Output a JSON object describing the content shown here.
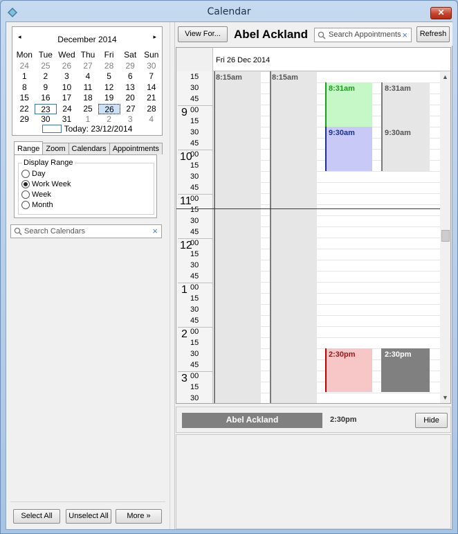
{
  "window": {
    "title": "Calendar",
    "close_label": "✕"
  },
  "mini_calendar": {
    "prev_label": "◂",
    "next_label": "▸",
    "month_title": "December 2014",
    "day_headers": [
      "Mon",
      "Tue",
      "Wed",
      "Thu",
      "Fri",
      "Sat",
      "Sun"
    ],
    "weeks": [
      [
        "24",
        "25",
        "26",
        "27",
        "28",
        "29",
        "30"
      ],
      [
        "1",
        "2",
        "3",
        "4",
        "5",
        "6",
        "7"
      ],
      [
        "8",
        "9",
        "10",
        "11",
        "12",
        "13",
        "14"
      ],
      [
        "15",
        "16",
        "17",
        "18",
        "19",
        "20",
        "21"
      ],
      [
        "22",
        "23",
        "24",
        "25",
        "26",
        "27",
        "28"
      ],
      [
        "29",
        "30",
        "31",
        "1",
        "2",
        "3",
        "4"
      ]
    ],
    "today_text": "Today: 23/12/2014"
  },
  "left_tabs": [
    "Range",
    "Zoom",
    "Calendars",
    "Appointments"
  ],
  "display_range": {
    "label": "Display Range",
    "options": [
      "Day",
      "Work Week",
      "Week",
      "Month"
    ],
    "selected": "Work Week"
  },
  "search_calendars": {
    "placeholder": "Search Calendars",
    "clear": "×"
  },
  "left_buttons": {
    "select_all": "Select All",
    "unselect_all": "Unselect All",
    "more": "More »"
  },
  "toolbar": {
    "view_for": "View For...",
    "owner": "Abel Ackland",
    "search_placeholder": "Search Appointments",
    "search_clear": "×",
    "refresh": "Refresh"
  },
  "day_view": {
    "date_header": "Fri 26 Dec 2014",
    "time_labels": [
      {
        "h": "",
        "m": "15"
      },
      {
        "h": "",
        "m": "30"
      },
      {
        "h": "",
        "m": "45"
      },
      {
        "h": "9",
        "m": "00"
      },
      {
        "h": "",
        "m": "15"
      },
      {
        "h": "",
        "m": "30"
      },
      {
        "h": "",
        "m": "45"
      },
      {
        "h": "10",
        "m": "00"
      },
      {
        "h": "",
        "m": "15"
      },
      {
        "h": "",
        "m": "30"
      },
      {
        "h": "",
        "m": "45"
      },
      {
        "h": "11",
        "m": "00"
      },
      {
        "h": "",
        "m": "15"
      },
      {
        "h": "",
        "m": "30"
      },
      {
        "h": "",
        "m": "45"
      },
      {
        "h": "12",
        "m": "00"
      },
      {
        "h": "",
        "m": "15"
      },
      {
        "h": "",
        "m": "30"
      },
      {
        "h": "",
        "m": "45"
      },
      {
        "h": "1",
        "m": "00"
      },
      {
        "h": "",
        "m": "15"
      },
      {
        "h": "",
        "m": "30"
      },
      {
        "h": "",
        "m": "45"
      },
      {
        "h": "2",
        "m": "00"
      },
      {
        "h": "",
        "m": "15"
      },
      {
        "h": "",
        "m": "30"
      },
      {
        "h": "",
        "m": "45"
      },
      {
        "h": "3",
        "m": "00"
      },
      {
        "h": "",
        "m": "15"
      },
      {
        "h": "",
        "m": "30"
      }
    ],
    "appointments": [
      {
        "label": "8:15am",
        "color": "#e6e6e6",
        "text_color": "#555555"
      },
      {
        "label": "8:15am",
        "color": "#e6e6e6",
        "text_color": "#555555"
      },
      {
        "label": "8:31am",
        "color": "#c6f7c6",
        "text_color": "#1f9a1f"
      },
      {
        "label": "8:31am",
        "color": "#e6e6e6",
        "text_color": "#555555"
      },
      {
        "label": "9:30am",
        "color": "#c9c9f7",
        "text_color": "#1a2f8f"
      },
      {
        "label": "9:30am",
        "color": "#e6e6e6",
        "text_color": "#555555"
      },
      {
        "label": "2:30pm",
        "color": "#f7c6c6",
        "text_color": "#8f1a1a"
      },
      {
        "label": "2:30pm",
        "color": "#808080",
        "text_color": "#ffffff"
      }
    ]
  },
  "detail": {
    "name": "Abel Ackland",
    "time": "2:30pm",
    "hide": "Hide"
  }
}
